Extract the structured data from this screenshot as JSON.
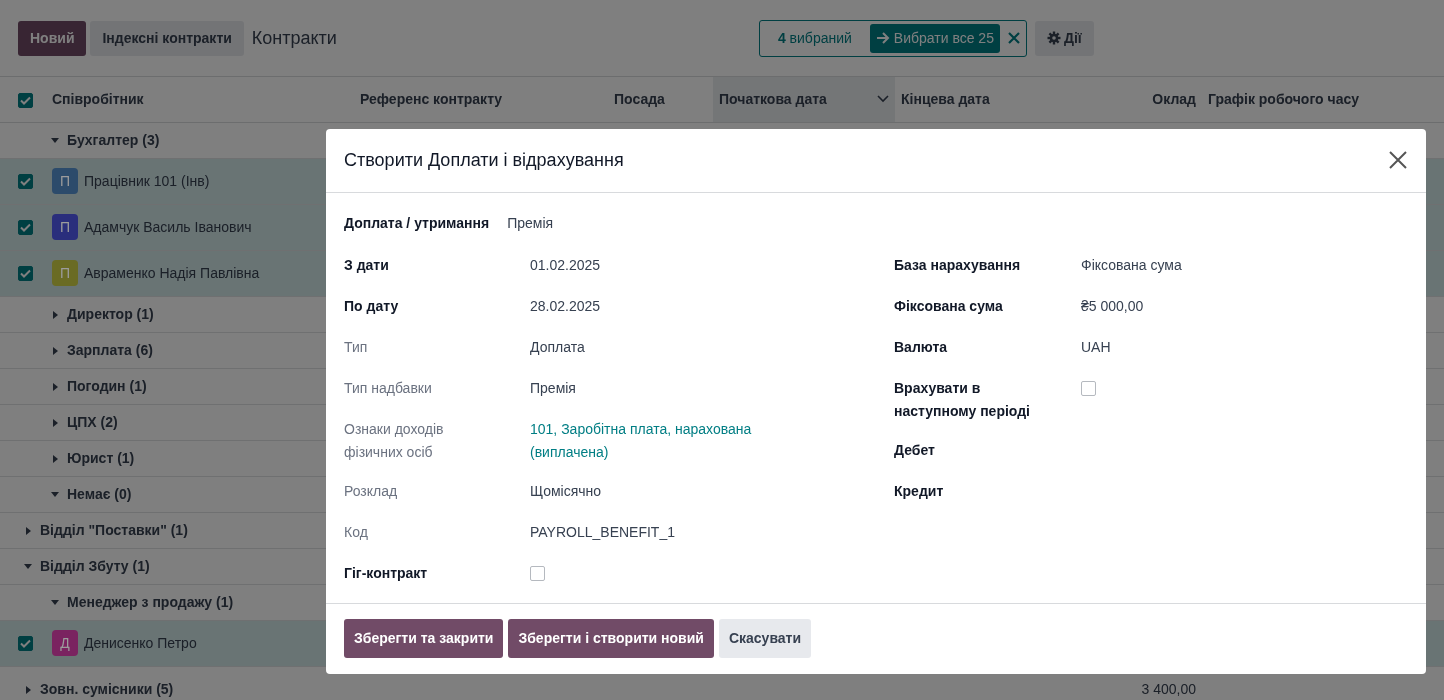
{
  "toolbar": {
    "new_button": "Новий",
    "secondary_button": "Індексні контракти",
    "breadcrumb": "Контракти",
    "selection": {
      "count_text": "**4** вибраний",
      "select_all": "Вибрати все 25"
    },
    "actions_button": "Дії"
  },
  "table": {
    "header_checkbox": {
      "checked": true
    },
    "columns": [
      {
        "label": "Співробітник",
        "sorted": false,
        "kind": "text"
      },
      {
        "label": "Референс контракту",
        "sorted": false,
        "kind": "text"
      },
      {
        "label": "Посада",
        "sorted": false,
        "kind": "text"
      },
      {
        "label": "Початкова дата",
        "sorted": true,
        "kind": "text"
      },
      {
        "label": "Кінцева дата",
        "sorted": false,
        "kind": "text"
      },
      {
        "label": "Оклад",
        "sorted": false,
        "kind": "numeric"
      },
      {
        "label": "Графік робочого часу",
        "sorted": false,
        "kind": "text"
      }
    ],
    "continued_groups": [
      {
        "kind": "group",
        "label": "Бухгалтер (3)",
        "expanded": true,
        "children": [
          {
            "kind": "record",
            "name": "Працівник 101 (Інв)",
            "avatar": "П",
            "color": "#2c4b6b",
            "selected": true
          },
          {
            "kind": "record",
            "name": "Адамчук Василь Іванович",
            "avatar": "П",
            "color": "#2a2e7c",
            "selected": true
          },
          {
            "kind": "record",
            "name": "Авраменко Надія Павлівна",
            "avatar": "П",
            "color": "#6a6b24",
            "selected": true
          }
        ]
      },
      {
        "kind": "group",
        "label": "Директор (1)",
        "expanded": false
      },
      {
        "kind": "group",
        "label": "Зарплата (6)",
        "expanded": false
      },
      {
        "kind": "group",
        "label": "Погодин (1)",
        "expanded": false
      },
      {
        "kind": "group",
        "label": "ЦПХ (2)",
        "expanded": false
      },
      {
        "kind": "group",
        "label": "Юрист (1)",
        "expanded": false
      },
      {
        "kind": "group",
        "label": "Немає (0)",
        "expanded": true
      }
    ],
    "groups": [
      {
        "kind": "group",
        "label": "Відділ \"Поставки\" (1)",
        "expanded": false
      },
      {
        "kind": "group",
        "label": "Відділ Збуту (1)",
        "expanded": true,
        "children": [
          {
            "kind": "group",
            "label": "Менеджер з продажу (1)",
            "expanded": true,
            "children": [
              {
                "kind": "record",
                "name": "Денисенко Петро",
                "avatar": "Д",
                "color": "#7a2360",
                "selected": true
              }
            ]
          }
        ]
      },
      {
        "kind": "group",
        "label": "Зовн. сумісники (5)",
        "expanded": false,
        "salary_total": "3 400,00"
      }
    ]
  },
  "dialog": {
    "title": "Створити Доплати і відрахування",
    "top_field": {
      "label": "Доплата / утримання",
      "value": "Премія"
    },
    "left_fields": [
      {
        "label": "З дати",
        "bold": true,
        "kind": "text",
        "value": "01.02.2025"
      },
      {
        "label": "По дату",
        "bold": true,
        "kind": "text",
        "value": "28.02.2025"
      },
      {
        "label": "Тип",
        "bold": false,
        "kind": "text",
        "value": "Доплата"
      },
      {
        "label": "Тип надбавки",
        "bold": false,
        "kind": "text",
        "value": "Премія"
      },
      {
        "label": "Ознаки доходів фізичних осіб",
        "bold": false,
        "kind": "link",
        "value": "101, Заробітна плата, нарахована (виплачена)"
      },
      {
        "label": "Розклад",
        "bold": false,
        "kind": "text",
        "value": "Щомісячно"
      },
      {
        "label": "Код",
        "bold": false,
        "kind": "text",
        "value": "PAYROLL_BENEFIT_1"
      },
      {
        "label": "Гіг-контракт",
        "bold": true,
        "kind": "checkbox",
        "checked": false
      }
    ],
    "right_fields": [
      {
        "label": "База нарахування",
        "bold": true,
        "kind": "text",
        "value": "Фіксована сума"
      },
      {
        "label": "Фіксована сума",
        "bold": true,
        "kind": "text",
        "value": "₴5 000,00"
      },
      {
        "label": "Валюта",
        "bold": true,
        "kind": "text",
        "value": "UAH"
      },
      {
        "label": "Врахувати в наступному періоді",
        "bold": true,
        "kind": "checkbox",
        "checked": false
      },
      {
        "label": "Дебет",
        "bold": true,
        "kind": "empty"
      },
      {
        "label": "Кредит",
        "bold": true,
        "kind": "empty"
      }
    ],
    "buttons": [
      {
        "label": "Зберегти та закрити",
        "kind": "primary"
      },
      {
        "label": "Зберегти і створити новий",
        "kind": "primary"
      },
      {
        "label": "Скасувати",
        "kind": "secondary"
      }
    ]
  }
}
